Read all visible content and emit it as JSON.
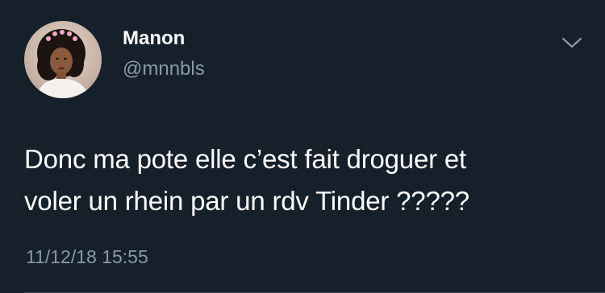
{
  "tweet": {
    "author": {
      "display_name": "Manon",
      "handle": "@mnnbls",
      "avatar_icon": "profile-photo"
    },
    "text_line_1": "Donc ma pote elle c’est fait droguer et",
    "text_line_2": "voler un rhein par un rdv Tinder ?????",
    "timestamp": "11/12/18 15:55",
    "menu_icon": "chevron-down-icon"
  },
  "colors": {
    "background": "#15202b",
    "primary_text": "#ffffff",
    "secondary_text": "#8899a6",
    "divider": "#38444d"
  }
}
